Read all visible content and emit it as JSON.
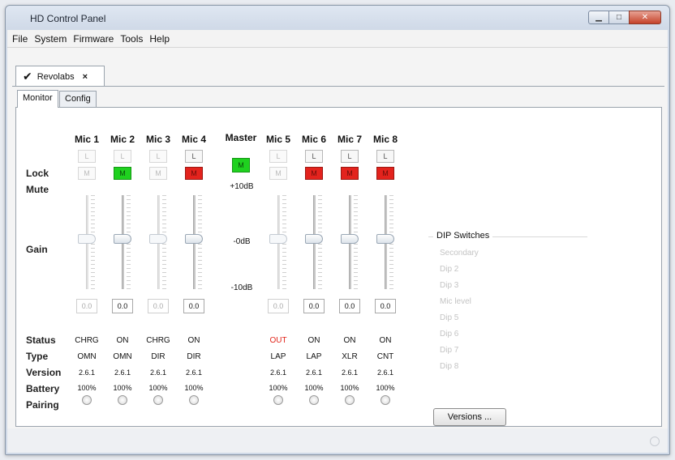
{
  "window": {
    "title": "HD Control Panel"
  },
  "menu": [
    "File",
    "System",
    "Firmware",
    "Tools",
    "Help"
  ],
  "doc_tab": {
    "label": "Revolabs",
    "close": "×"
  },
  "sub_tabs": [
    "Monitor",
    "Config"
  ],
  "row_labels": {
    "lock": "Lock",
    "mute": "Mute",
    "gain": "Gain",
    "status": "Status",
    "type": "Type",
    "version": "Version",
    "battery": "Battery",
    "pairing": "Pairing"
  },
  "lock_button_text": "L",
  "mute_button_text": "M",
  "mics": [
    {
      "name": "Mic 1",
      "lock_enabled": false,
      "mute": "off-dim",
      "value": "0.0",
      "status": "CHRG",
      "type": "OMN",
      "version": "2.6.1",
      "battery": "100%",
      "dim": true
    },
    {
      "name": "Mic 2",
      "lock_enabled": false,
      "mute": "green",
      "value": "0.0",
      "status": "ON",
      "type": "OMN",
      "version": "2.6.1",
      "battery": "100%",
      "dim": false
    },
    {
      "name": "Mic 3",
      "lock_enabled": false,
      "mute": "off-dim",
      "value": "0.0",
      "status": "CHRG",
      "type": "DIR",
      "version": "2.6.1",
      "battery": "100%",
      "dim": true
    },
    {
      "name": "Mic 4",
      "lock_enabled": true,
      "mute": "red",
      "value": "0.0",
      "status": "ON",
      "type": "DIR",
      "version": "2.6.1",
      "battery": "100%",
      "dim": false
    },
    {
      "name": "Mic 5",
      "lock_enabled": false,
      "mute": "off-dim",
      "value": "0.0",
      "status": "OUT",
      "type": "LAP",
      "version": "2.6.1",
      "battery": "100%",
      "dim": true,
      "status_red": true
    },
    {
      "name": "Mic 6",
      "lock_enabled": true,
      "mute": "red",
      "value": "0.0",
      "status": "ON",
      "type": "LAP",
      "version": "2.6.1",
      "battery": "100%",
      "dim": false
    },
    {
      "name": "Mic 7",
      "lock_enabled": true,
      "mute": "red",
      "value": "0.0",
      "status": "ON",
      "type": "XLR",
      "version": "2.6.1",
      "battery": "100%",
      "dim": false
    },
    {
      "name": "Mic 8",
      "lock_enabled": true,
      "mute": "red",
      "value": "0.0",
      "status": "ON",
      "type": "CNT",
      "version": "2.6.1",
      "battery": "100%",
      "dim": false
    }
  ],
  "master": {
    "name": "Master",
    "button": "M",
    "db_top": "+10dB",
    "db_mid": "-0dB",
    "db_bot": "-10dB"
  },
  "dip": {
    "legend": "DIP Switches",
    "items": [
      "Secondary",
      "Dip 2",
      "Dip 3",
      "Mic level",
      "Dip 5",
      "Dip 6",
      "Dip 7",
      "Dip 8"
    ]
  },
  "versions_button": "Versions ..."
}
